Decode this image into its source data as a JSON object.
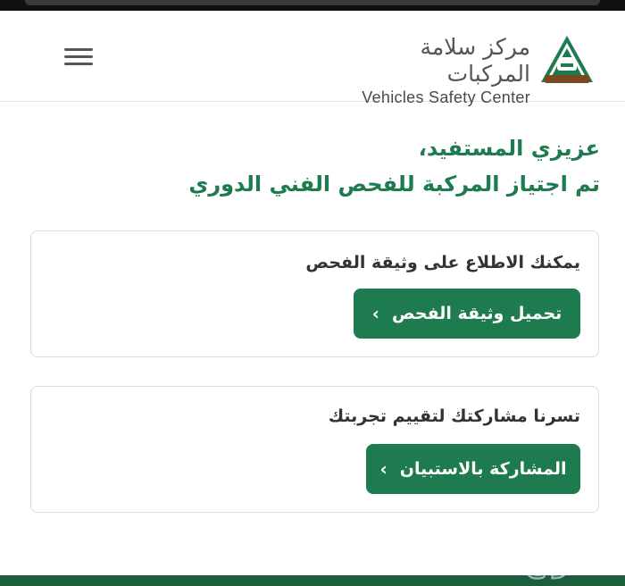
{
  "header": {
    "brand_ar": "مركز سلامة المركبات",
    "brand_en": "Vehicles Safety Center",
    "menu_icon": "hamburger-menu-icon",
    "logo_icon": "vehicle-triangle-logo"
  },
  "greeting": {
    "line1": "عزيزي المستفيد،",
    "line2": "تم اجتياز المركبة للفحص الفني الدوري"
  },
  "cards": [
    {
      "text": "يمكنك الاطلاع على وثيقة الفحص",
      "button_label": "تحميل وثيقة الفحص"
    },
    {
      "text": "تسرنا مشاركتك لتقييم تجربتك",
      "button_label": "المشاركة بالاستبيان"
    }
  ],
  "colors": {
    "primary_green": "#1e7a4f",
    "footer_green": "#1b5d3c",
    "logo_brown": "#7a4a1e"
  },
  "watermark_text": "حراج"
}
